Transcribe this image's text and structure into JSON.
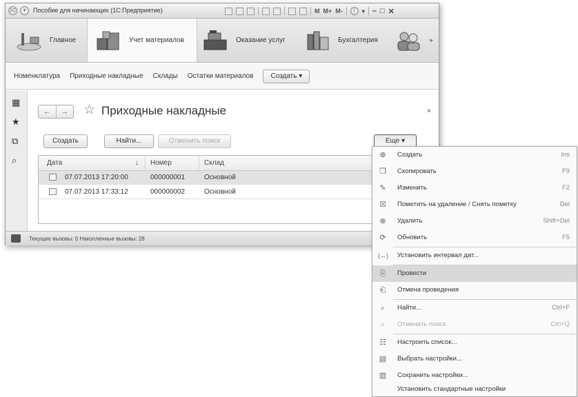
{
  "window": {
    "title": "Пособие для начинающих (1С:Предприятие)",
    "m_buttons": [
      "M",
      "M+",
      "M-"
    ],
    "controls": [
      "–",
      "□",
      "✕"
    ]
  },
  "sections": [
    {
      "label": "Главное",
      "icon": "desk-icon"
    },
    {
      "label": "Учет материалов",
      "icon": "boxes-icon",
      "active": true
    },
    {
      "label": "Оказание услуг",
      "icon": "cash-register-icon"
    },
    {
      "label": "Бухгалтерия",
      "icon": "books-icon"
    },
    {
      "label": "",
      "icon": "people-icon"
    }
  ],
  "nav": {
    "links": [
      "Номенклатура",
      "Приходные накладные",
      "Склады",
      "Остатки материалов"
    ],
    "create_label": "Создать ▾"
  },
  "form": {
    "back": "←",
    "forward": "→",
    "title": "Приходные накладные",
    "close": "×",
    "buttons": {
      "create": "Создать",
      "find": "Найти...",
      "cancel_search": "Отменить поиск",
      "more": "Еще  ▾"
    },
    "columns": [
      "Дата",
      "↓",
      "Номер",
      "Склад"
    ],
    "rows": [
      {
        "date": "07.07.2013 17:20:00",
        "number": "000000001",
        "warehouse": "Основной"
      },
      {
        "date": "07.07.2013 17:33:12",
        "number": "000000002",
        "warehouse": "Основной"
      }
    ]
  },
  "status": {
    "text": "Текущие вызовы: 0   Накопленные вызовы: 28"
  },
  "menu": {
    "items": [
      {
        "label": "Создать",
        "key": "Ins",
        "icon": "plus-circle-icon"
      },
      {
        "label": "Скопировать",
        "key": "F9",
        "icon": "copy-icon"
      },
      {
        "label": "Изменить",
        "key": "F2",
        "icon": "pencil-icon"
      },
      {
        "label": "Пометить на удаление / Снять пометку",
        "key": "Del",
        "icon": "mark-delete-icon"
      },
      {
        "label": "Удалить",
        "key": "Shift+Del",
        "icon": "delete-icon"
      },
      {
        "label": "Обновить",
        "key": "F5",
        "icon": "refresh-icon"
      },
      {
        "label": "Установить интервал дат...",
        "key": "",
        "icon": "date-interval-icon"
      },
      {
        "label": "Провести",
        "key": "",
        "icon": "post-icon"
      },
      {
        "label": "Отмена проведения",
        "key": "",
        "icon": "unpost-icon"
      },
      {
        "label": "Найти...",
        "key": "Ctrl+F",
        "icon": "search-icon"
      },
      {
        "label": "Отменить поиск",
        "key": "Ctrl+Q",
        "icon": "cancel-search-icon"
      },
      {
        "label": "Настроить список...",
        "key": "",
        "icon": "list-settings-icon"
      },
      {
        "label": "Выбрать настройки...",
        "key": "",
        "icon": "load-settings-icon"
      },
      {
        "label": "Сохранить настройки...",
        "key": "",
        "icon": "save-settings-icon"
      },
      {
        "label": "Установить стандартные настройки",
        "key": "",
        "icon": ""
      }
    ]
  }
}
